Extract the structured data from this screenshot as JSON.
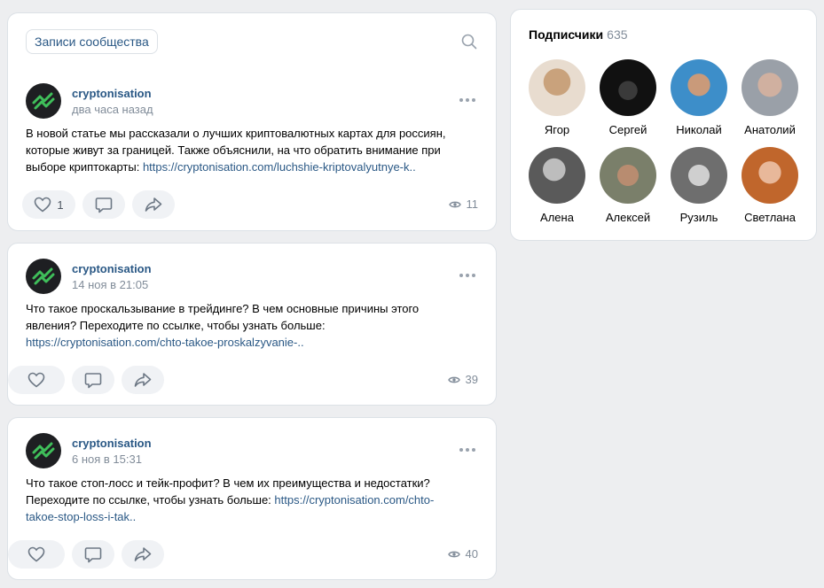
{
  "header": {
    "tab_label": "Записи сообщества",
    "search_icon": "search-icon"
  },
  "posts": [
    {
      "author": "cryptonisation",
      "time": "два часа назад",
      "text": "В новой статье мы рассказали о лучших криптовалютных картах для россиян, которые живут за границей. Также объяснили, на что обратить внимание при выборе криптокарты: ",
      "link": "https://cryptonisation.com/luchshie-kriptovalyutnye-k..",
      "likes": "1",
      "views": "11"
    },
    {
      "author": "cryptonisation",
      "time": "14 ноя в 21:05",
      "text": "Что такое проскальзывание в трейдинге? В чем основные причины этого явления? Переходите по ссылке, чтобы узнать больше: ",
      "link": "https://cryptonisation.com/chto-takoe-proskalzyvanie-..",
      "likes": "",
      "views": "39"
    },
    {
      "author": "cryptonisation",
      "time": "6 ноя в 15:31",
      "text": "Что такое стоп-лосс и тейк-профит? В чем их преимущества и недостатки? Переходите по ссылке, чтобы узнать больше: ",
      "link": "https://cryptonisation.com/chto-takoe-stop-loss-i-tak..",
      "likes": "",
      "views": "40"
    }
  ],
  "subscribers": {
    "title": "Подписчики",
    "count": "635",
    "people": [
      {
        "name": "Ягор",
        "color": "#c9a27c"
      },
      {
        "name": "Сергей",
        "color": "#1a1a1a"
      },
      {
        "name": "Николай",
        "color": "#3d8ec9"
      },
      {
        "name": "Анатолий",
        "color": "#9aa0a8"
      },
      {
        "name": "Алена",
        "color": "#6d6d6d"
      },
      {
        "name": "Алексей",
        "color": "#7a7f6a"
      },
      {
        "name": "Рузиль",
        "color": "#8c8c8c"
      },
      {
        "name": "Светлана",
        "color": "#c0662c"
      }
    ]
  },
  "colors": {
    "link": "#2a5885",
    "muted": "#818c99",
    "logo_green": "#3fbf5a"
  }
}
